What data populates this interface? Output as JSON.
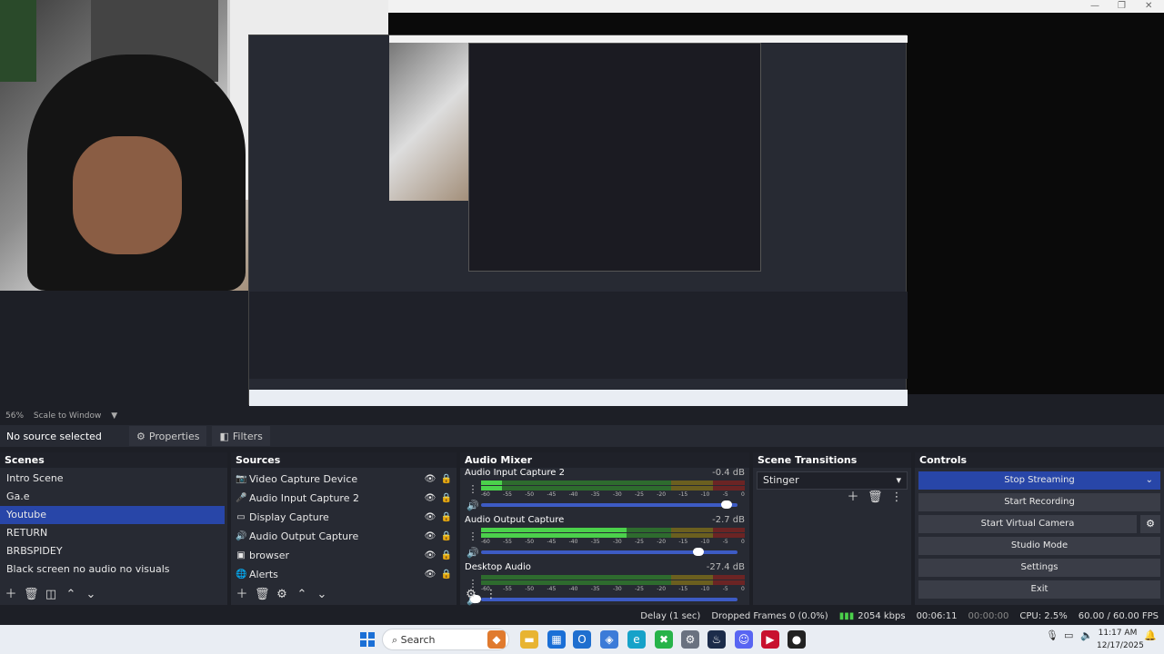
{
  "preview": {
    "zoom": "56%",
    "scale_mode": "Scale to Window"
  },
  "context": {
    "selection": "No source selected",
    "properties": "Properties",
    "filters": "Filters"
  },
  "scenes": {
    "title": "Scenes",
    "items": [
      "Intro Scene",
      "Ga.e",
      "Youtube",
      "RETURN",
      "BRBSPIDEY",
      "Black screen no audio no visuals"
    ],
    "selected_index": 2
  },
  "sources": {
    "title": "Sources",
    "items": [
      {
        "label": "Video Capture Device",
        "icon": "camera-icon"
      },
      {
        "label": "Audio Input Capture 2",
        "icon": "mic-icon"
      },
      {
        "label": "Display Capture",
        "icon": "monitor-icon"
      },
      {
        "label": "Audio Output Capture",
        "icon": "speaker-icon"
      },
      {
        "label": "browser",
        "icon": "browser-icon"
      },
      {
        "label": "Alerts",
        "icon": "globe-icon"
      }
    ]
  },
  "mixer": {
    "title": "Audio Mixer",
    "channels": [
      {
        "name": "Audio Input Capture 2",
        "db": "-0.4 dB",
        "level": 0.08,
        "volume": 0.98
      },
      {
        "name": "Audio Output Capture",
        "db": "-2.7 dB",
        "level": 0.55,
        "volume": 0.87
      },
      {
        "name": "Desktop Audio",
        "db": "-27.4 dB",
        "level": 0.0,
        "volume": 0.0
      }
    ],
    "scale": [
      "-60",
      "-55",
      "-50",
      "-45",
      "-40",
      "-35",
      "-30",
      "-25",
      "-20",
      "-15",
      "-10",
      "-5",
      "0"
    ]
  },
  "transitions": {
    "title": "Scene Transitions",
    "selected": "Stinger"
  },
  "controls": {
    "title": "Controls",
    "stop_streaming": "Stop Streaming",
    "start_recording": "Start Recording",
    "start_virtual_camera": "Start Virtual Camera",
    "studio_mode": "Studio Mode",
    "settings": "Settings",
    "exit": "Exit"
  },
  "status": {
    "delay": "Delay (1 sec)",
    "dropped": "Dropped Frames 0 (0.0%)",
    "bitrate": "2054 kbps",
    "stream_time": "00:06:11",
    "rec_time": "00:00:00",
    "cpu": "CPU: 2.5%",
    "fps": "60.00 / 60.00 FPS"
  },
  "taskbar": {
    "search": "Search",
    "time": "11:17 AM",
    "date": "12/17/2025"
  },
  "colors": {
    "accent": "#2846a8",
    "panel": "#272a33",
    "background": "#1d1f26"
  }
}
